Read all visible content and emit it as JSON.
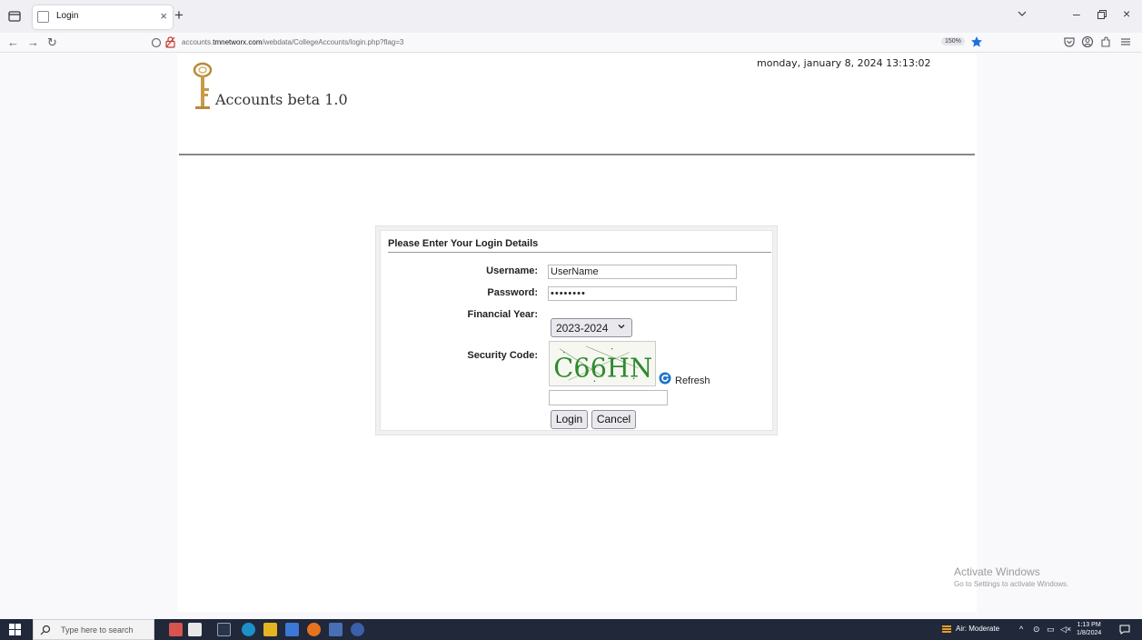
{
  "browser": {
    "tab_title": "Login",
    "url_prefix": "accounts.",
    "url_domain": "tmnetworx.com",
    "url_path": "/webdata/CollegeAccounts/login.php?flag=3",
    "zoom": "150%"
  },
  "header": {
    "app_title": "Accounts beta 1.0",
    "datetime": "monday, january 8, 2024 13:13:02"
  },
  "login": {
    "heading": "Please Enter Your Login Details",
    "username_label": "Username:",
    "username_value": "UserName",
    "password_label": "Password:",
    "password_value": "••••••••",
    "financial_year_label": "Financial Year:",
    "financial_year_value": "2023-2024",
    "security_code_label": "Security Code:",
    "captcha_text": "C66HN",
    "refresh_label": "Refresh",
    "security_code_value": "",
    "login_button": "Login",
    "cancel_button": "Cancel"
  },
  "watermark": {
    "line1": "Activate Windows",
    "line2": "Go to Settings to activate Windows."
  },
  "taskbar": {
    "search_placeholder": "Type here to search",
    "weather": "Air: Moderate",
    "time": "1:13 PM",
    "date": "1/8/2024"
  },
  "colors": {
    "captcha_green": "#2f8a2f",
    "taskbar_bg": "#20283a",
    "refresh_blue": "#1a73c8"
  }
}
